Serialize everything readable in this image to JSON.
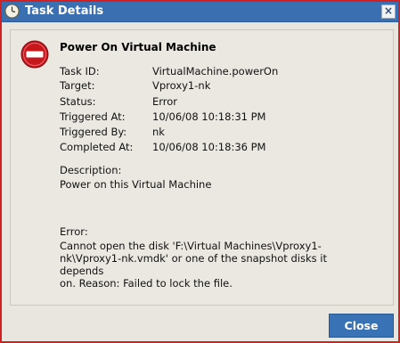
{
  "window": {
    "title": "Task Details",
    "close_glyph": "×",
    "title_icon": "clock-icon"
  },
  "task": {
    "heading": "Power On Virtual Machine",
    "status_icon": "error-stop-icon",
    "fields": [
      {
        "label": "Task ID:",
        "value": "VirtualMachine.powerOn"
      },
      {
        "label": "Target:",
        "value": "Vproxy1-nk"
      },
      {
        "label": "Status:",
        "value": "Error"
      },
      {
        "label": "Triggered At:",
        "value": "10/06/08 10:18:31 PM"
      },
      {
        "label": "Triggered By:",
        "value": "nk"
      },
      {
        "label": "Completed At:",
        "value": "10/06/08 10:18:36 PM"
      }
    ],
    "description_label": "Description:",
    "description_text": "Power on this Virtual Machine",
    "error_label": "Error:",
    "error_text": "Cannot open the disk 'F:\\Virtual Machines\\Vproxy1-\nnk\\Vproxy1-nk.vmdk' or one of the snapshot disks it depends\non.  Reason: Failed to lock the file."
  },
  "footer": {
    "close_label": "Close"
  },
  "colors": {
    "titlebar": "#3a6fb2",
    "window_border": "#d42020",
    "panel_bg": "#ebe8e1",
    "error_red": "#c8161d",
    "button_blue": "#3a73b5"
  }
}
